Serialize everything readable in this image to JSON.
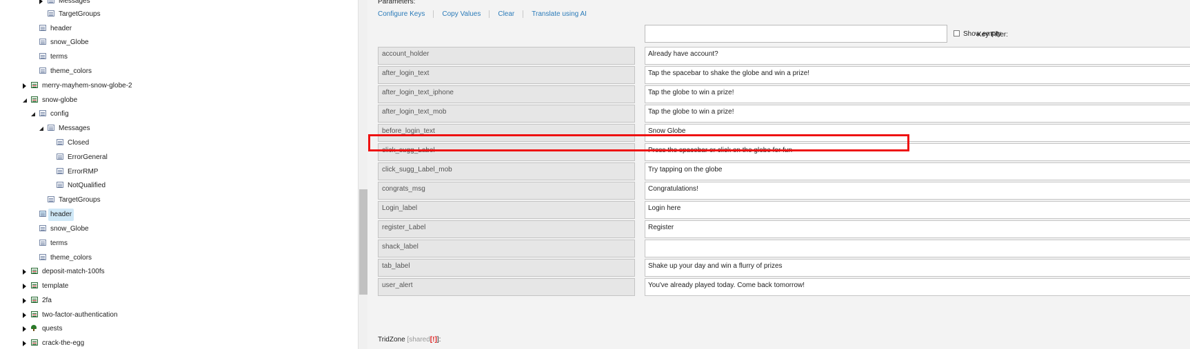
{
  "tree": {
    "items": [
      {
        "label": "Messages",
        "depth": 2,
        "expander": "closed",
        "icon": "list"
      },
      {
        "label": "TargetGroups",
        "depth": 2,
        "expander": "none",
        "icon": "list"
      },
      {
        "label": "header",
        "depth": 1,
        "expander": "none",
        "icon": "list"
      },
      {
        "label": "snow_Globe",
        "depth": 1,
        "expander": "none",
        "icon": "list"
      },
      {
        "label": "terms",
        "depth": 1,
        "expander": "none",
        "icon": "list"
      },
      {
        "label": "theme_colors",
        "depth": 1,
        "expander": "none",
        "icon": "list"
      },
      {
        "label": "merry-mayhem-snow-globe-2",
        "depth": 0,
        "expander": "closed",
        "icon": "pkg"
      },
      {
        "label": "snow-globe",
        "depth": 0,
        "expander": "open",
        "icon": "pkg"
      },
      {
        "label": "config",
        "depth": 1,
        "expander": "open",
        "icon": "list"
      },
      {
        "label": "Messages",
        "depth": 2,
        "expander": "open",
        "icon": "list"
      },
      {
        "label": "Closed",
        "depth": 3,
        "expander": "none",
        "icon": "list"
      },
      {
        "label": "ErrorGeneral",
        "depth": 3,
        "expander": "none",
        "icon": "list"
      },
      {
        "label": "ErrorRMP",
        "depth": 3,
        "expander": "none",
        "icon": "list"
      },
      {
        "label": "NotQualified",
        "depth": 3,
        "expander": "none",
        "icon": "list"
      },
      {
        "label": "TargetGroups",
        "depth": 2,
        "expander": "none",
        "icon": "list"
      },
      {
        "label": "header",
        "depth": 1,
        "expander": "none",
        "icon": "list",
        "selected": true
      },
      {
        "label": "snow_Globe",
        "depth": 1,
        "expander": "none",
        "icon": "list"
      },
      {
        "label": "terms",
        "depth": 1,
        "expander": "none",
        "icon": "list"
      },
      {
        "label": "theme_colors",
        "depth": 1,
        "expander": "none",
        "icon": "list"
      },
      {
        "label": "deposit-match-100fs",
        "depth": 0,
        "expander": "closed",
        "icon": "pkg"
      },
      {
        "label": "template",
        "depth": 0,
        "expander": "closed",
        "icon": "pkg"
      },
      {
        "label": "2fa",
        "depth": 0,
        "expander": "closed",
        "icon": "pkg"
      },
      {
        "label": "two-factor-authentication",
        "depth": 0,
        "expander": "closed",
        "icon": "pkg"
      },
      {
        "label": "quests",
        "depth": 0,
        "expander": "closed",
        "icon": "quest"
      },
      {
        "label": "crack-the-egg",
        "depth": 0,
        "expander": "closed",
        "icon": "pkg"
      }
    ]
  },
  "params": {
    "title": "Parameters:",
    "toolbar": [
      "Configure Keys",
      "Copy Values",
      "Clear",
      "Translate using AI"
    ],
    "filter_label": "Key Filter:",
    "filter_value": "",
    "show_empty_label": "Show empty",
    "rows": [
      {
        "key": "account_holder",
        "value": "Already have account?"
      },
      {
        "key": "after_login_text",
        "value": "Tap the spacebar to shake the globe and win a prize!"
      },
      {
        "key": "after_login_text_iphone",
        "value": "Tap the globe to win a prize!"
      },
      {
        "key": "after_login_text_mob",
        "value": "Tap the globe to win a prize!"
      },
      {
        "key": "before_login_text",
        "value": "Snow Globe"
      },
      {
        "key": "click_sugg_Label",
        "value": "Press the spacebar or click on the globe for fun"
      },
      {
        "key": "click_sugg_Label_mob",
        "value": "Try tapping on the globe"
      },
      {
        "key": "congrats_msg",
        "value": "Congratulations!"
      },
      {
        "key": "Login_label",
        "value": "Login here"
      },
      {
        "key": "register_Label",
        "value": "Register"
      },
      {
        "key": "shack_label",
        "value": ""
      },
      {
        "key": "tab_label",
        "value": "Shake up your day and win a flurry of prizes"
      },
      {
        "key": "user_alert",
        "value": "You've already played today. Come back tomorrow!"
      }
    ],
    "highlight_color": "#ee1111",
    "link_color": "#2b7bb9"
  },
  "tridzone": {
    "label": "TridZone",
    "shared": "[shared",
    "mark": "[!]",
    "suffix": "]:"
  }
}
